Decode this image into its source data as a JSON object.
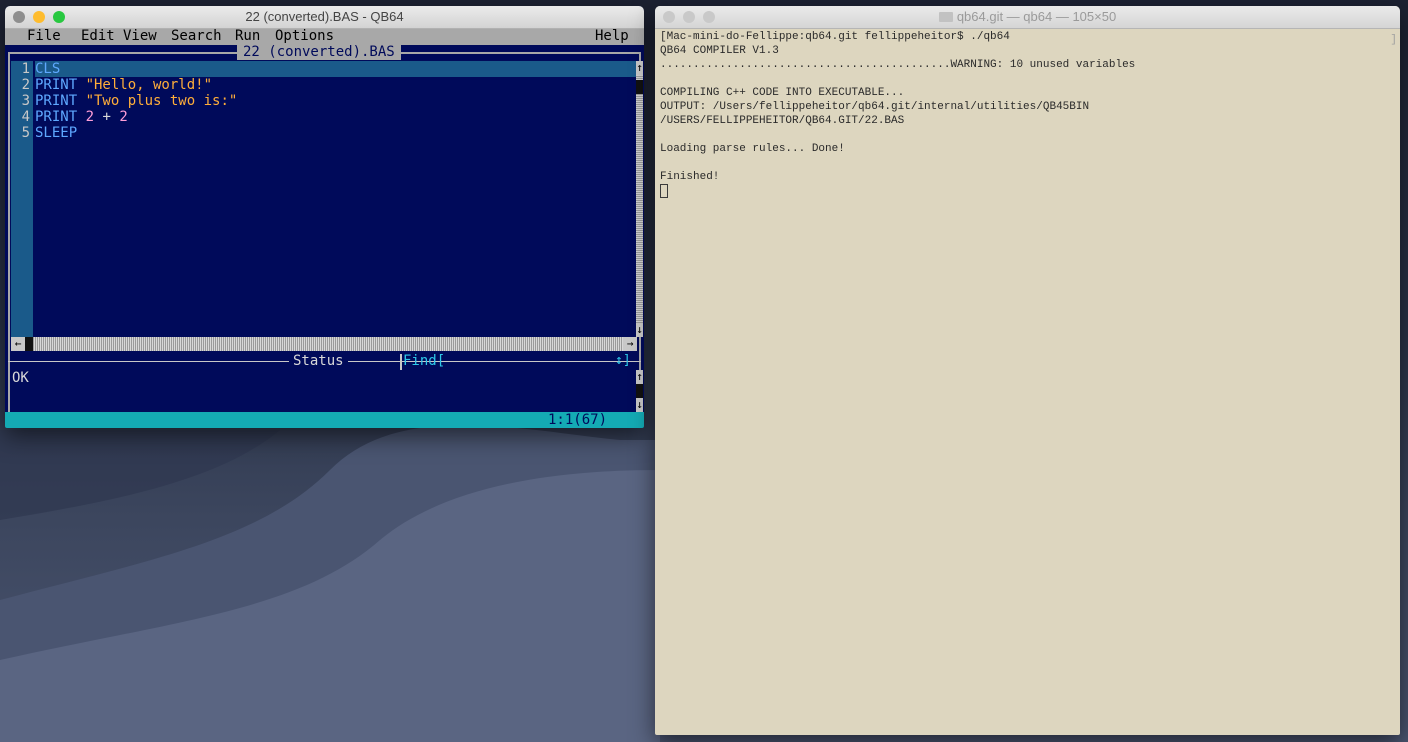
{
  "qb64": {
    "title": "22 (converted).BAS - QB64",
    "menu": [
      {
        "label": "File"
      },
      {
        "label": "Edit"
      },
      {
        "label": "View"
      },
      {
        "label": "Search"
      },
      {
        "label": "Run"
      },
      {
        "label": "Options"
      },
      {
        "label": "Help"
      }
    ],
    "file_tab": "22 (converted).BAS",
    "line_numbers": [
      "1",
      "2",
      "3",
      "4",
      "5"
    ],
    "code": [
      [
        {
          "t": "CLS",
          "c": "kw"
        }
      ],
      [
        {
          "t": "PRINT ",
          "c": "kw"
        },
        {
          "t": "\"Hello, world!\"",
          "c": "str"
        }
      ],
      [
        {
          "t": "PRINT ",
          "c": "kw"
        },
        {
          "t": "\"Two plus two is:\"",
          "c": "str"
        }
      ],
      [
        {
          "t": "PRINT ",
          "c": "kw"
        },
        {
          "t": "2",
          "c": "num"
        },
        {
          "t": " + ",
          "c": "op"
        },
        {
          "t": "2",
          "c": "num"
        }
      ],
      [
        {
          "t": "SLEEP",
          "c": "kw"
        }
      ]
    ],
    "status_title": "Status",
    "find_label": "Find[",
    "find_end": "↕]",
    "status_text": "OK",
    "cursor_position": "1:1(67)",
    "colors": {
      "editor_bg": "#000a5a",
      "menu_bg": "#a8a8a8",
      "status_bar": "#14aab4",
      "keyword": "#5ea8ff",
      "string": "#ffae3a",
      "number": "#ff9ed8"
    }
  },
  "terminal": {
    "title": "qb64.git — qb64 — 105×50",
    "lines": [
      "[Mac-mini-do-Fellippe:qb64.git fellippeheitor$ ./qb64",
      "QB64 COMPILER V1.3",
      "............................................WARNING: 10 unused variables",
      "",
      "COMPILING C++ CODE INTO EXECUTABLE...",
      "OUTPUT: /Users/fellippeheitor/qb64.git/internal/utilities/QB45BIN",
      "/USERS/FELLIPPEHEITOR/QB64.GIT/22.BAS",
      "",
      "Loading parse rules... Done!",
      "",
      "Finished!"
    ],
    "colors": {
      "bg": "#ddd6bf",
      "fg": "#2a2a2a"
    }
  }
}
